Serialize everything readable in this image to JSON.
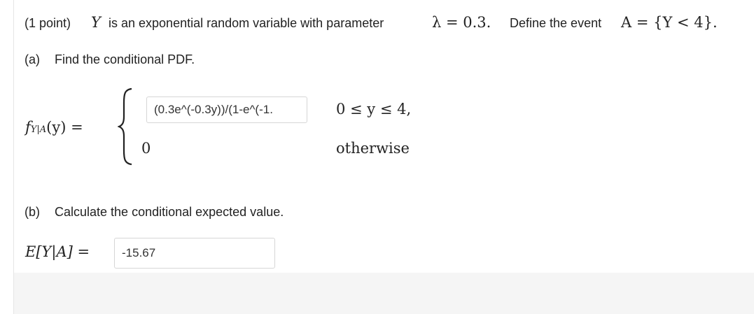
{
  "header": {
    "points": "(1 point)",
    "var": "Y",
    "text1": "is an exponential random variable with parameter",
    "lambda_eq": "λ = 0.3.",
    "text2": "Define the event",
    "event": "A = {Y < 4}."
  },
  "part_a": {
    "label": "(a)",
    "text": "Find the conditional PDF.",
    "lhs_f": "f",
    "lhs_sub": "Y|A",
    "lhs_rest": "(y) =",
    "input_value": "(0.3e^(-0.3y))/(1-e^(-1.",
    "condition1": "0 ≤ y ≤ 4,",
    "zero": "0",
    "otherwise": "otherwise"
  },
  "part_b": {
    "label": "(b)",
    "text": "Calculate the conditional expected value.",
    "lhs": "E[Y|A] =",
    "input_value": "-15.67"
  }
}
